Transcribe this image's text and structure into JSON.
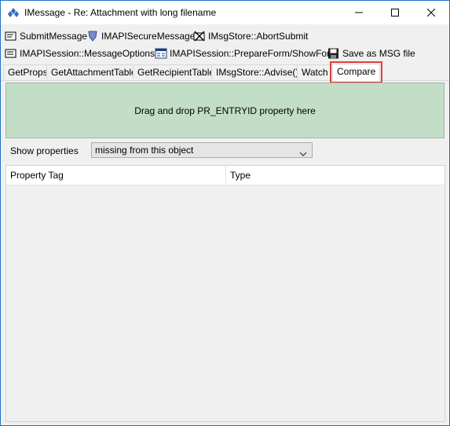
{
  "window": {
    "title": "IMessage - Re: Attachment with long filename",
    "icon": "diamond-app-icon",
    "controls": [
      "minimize",
      "maximize",
      "close"
    ]
  },
  "toolbar1": {
    "buttons": [
      {
        "label": "SubmitMessage",
        "icon": "submit-icon"
      },
      {
        "label": "IMAPISecureMessage",
        "icon": "shield-icon"
      },
      {
        "label": "IMsgStore::AbortSubmit",
        "icon": "abort-icon"
      }
    ]
  },
  "toolbar2": {
    "buttons": [
      {
        "label": "IMAPISession::MessageOptions()",
        "icon": "options-icon"
      },
      {
        "label": "IMAPISession::PrepareForm/ShowForm",
        "icon": "form-icon"
      },
      {
        "label": "Save as MSG file",
        "icon": "save-icon"
      }
    ]
  },
  "tabs": [
    {
      "label": "GetProps"
    },
    {
      "label": "GetAttachmentTable"
    },
    {
      "label": "GetRecipientTable"
    },
    {
      "label": "IMsgStore::Advise()"
    },
    {
      "label": "Watch"
    },
    {
      "label": "Compare",
      "active": true
    }
  ],
  "dropzone": {
    "text": "Drag and drop PR_ENTRYID property here",
    "color": "#c2dec6"
  },
  "show_properties": {
    "label": "Show properties",
    "selected": "missing from this object"
  },
  "grid": {
    "columns": [
      "Property Tag",
      "Type"
    ],
    "rows": []
  },
  "colors": {
    "highlight": "#e04040",
    "window_border": "#1e73c8"
  }
}
